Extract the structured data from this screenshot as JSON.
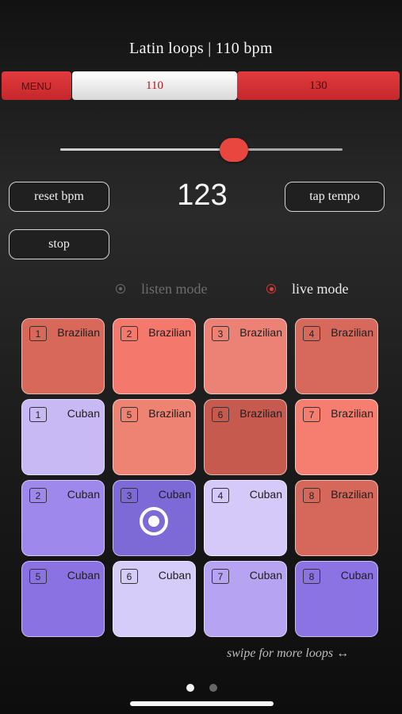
{
  "header": {
    "title": "Latin loops | 110 bpm"
  },
  "tabs": [
    {
      "label": "MENU"
    },
    {
      "label": "110",
      "selected": true
    },
    {
      "label": "130"
    }
  ],
  "tempo": {
    "slider_value": 123,
    "slider_min": 80,
    "slider_max": 150,
    "bpm_display": "123",
    "reset_label": "reset bpm",
    "tap_label": "tap tempo",
    "stop_label": "stop"
  },
  "modes": {
    "listen_label": "listen mode",
    "live_label": "live mode",
    "active": "live"
  },
  "pads": [
    {
      "num": "1",
      "label": "Brazilian",
      "color": "#d8685a"
    },
    {
      "num": "2",
      "label": "Brazilian",
      "color": "#f4786b"
    },
    {
      "num": "3",
      "label": "Brazilian",
      "color": "#ec8275"
    },
    {
      "num": "4",
      "label": "Brazilian",
      "color": "#d6695b"
    },
    {
      "num": "1",
      "label": "Cuban",
      "color": "#c8b8f4"
    },
    {
      "num": "5",
      "label": "Brazilian",
      "color": "#ee8373"
    },
    {
      "num": "6",
      "label": "Brazilian",
      "color": "#c65a4e"
    },
    {
      "num": "7",
      "label": "Brazilian",
      "color": "#f67e70"
    },
    {
      "num": "2",
      "label": "Cuban",
      "color": "#9f88ec"
    },
    {
      "num": "3",
      "label": "Cuban",
      "color": "#7d6ad6",
      "playing": true
    },
    {
      "num": "4",
      "label": "Cuban",
      "color": "#d4c9f8"
    },
    {
      "num": "8",
      "label": "Brazilian",
      "color": "#d5685a"
    },
    {
      "num": "5",
      "label": "Cuban",
      "color": "#8a72e2"
    },
    {
      "num": "6",
      "label": "Cuban",
      "color": "#d6ccf9"
    },
    {
      "num": "7",
      "label": "Cuban",
      "color": "#b6a3f2"
    },
    {
      "num": "8",
      "label": "Cuban",
      "color": "#8b73e4"
    }
  ],
  "footer": {
    "swipe_hint": "swipe for more loops ↔",
    "page_count": 2,
    "active_page": 0
  },
  "colors": {
    "accent_red": "#e8463f",
    "tab_red": "#d6302f"
  }
}
